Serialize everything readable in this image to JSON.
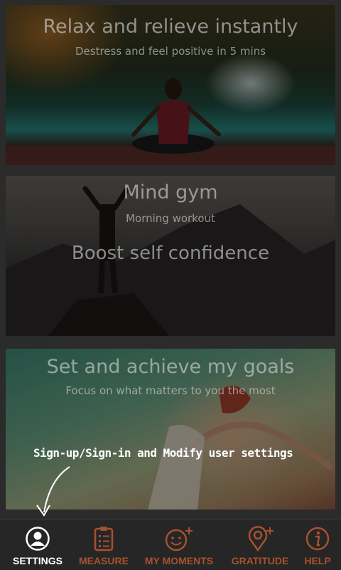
{
  "cards": [
    {
      "title": "Relax and relieve instantly",
      "subtitle": "Destress and feel positive in 5 mins"
    },
    {
      "title": "Mind gym",
      "subtitle": "Morning workout",
      "extra": "Boost self confidence"
    },
    {
      "title": "Set and achieve my goals",
      "subtitle": "Focus on what matters to you the most"
    }
  ],
  "hint": "Sign-up/Sign-in  and Modify user settings",
  "tabs": [
    {
      "label": "SETTINGS",
      "icon": "user-circle-icon",
      "active": true
    },
    {
      "label": "MEASURE",
      "icon": "clipboard-icon",
      "active": false
    },
    {
      "label": "MY MOMENTS",
      "icon": "smiley-plus-icon",
      "active": false
    },
    {
      "label": "GRATITUDE",
      "icon": "map-pin-plus-icon",
      "active": false
    },
    {
      "label": "HELP",
      "icon": "info-icon",
      "active": false
    }
  ],
  "colors": {
    "active": "#ffffff",
    "inactive": "#a6522e",
    "tabbar": "#262626"
  }
}
